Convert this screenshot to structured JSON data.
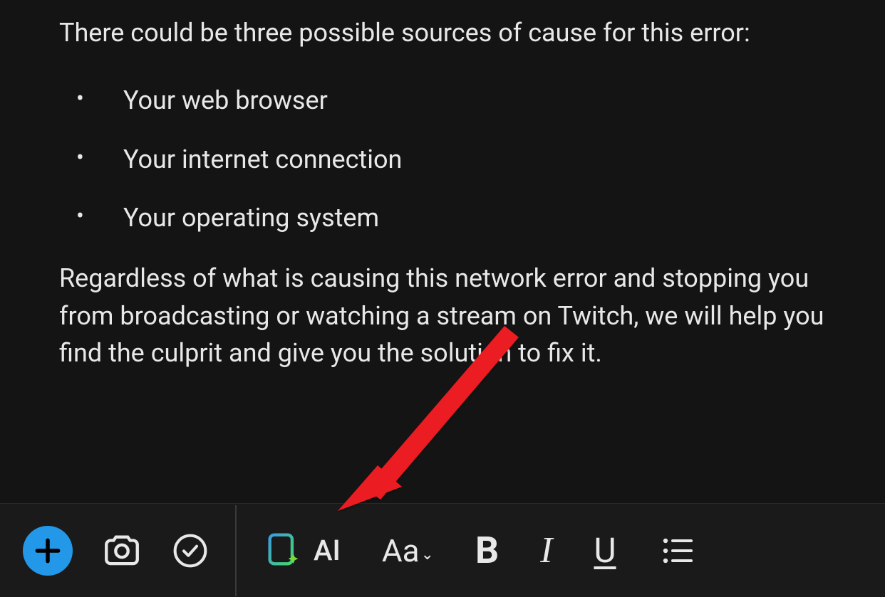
{
  "content": {
    "intro": "There could be three possible sources of cause for this error:",
    "bullets": [
      "Your web browser",
      "Your internet connection",
      "Your operating system"
    ],
    "outro": "Regardless of what is causing this network error and stopping you from broadcasting or watching a stream on Twitch, we will help you find the culprit and give you the solution to fix it."
  },
  "annotation": {
    "arrow_color": "#eb1c24"
  },
  "toolbar": {
    "ai_label": "AI",
    "format_label": "Aa",
    "bold_label": "B",
    "italic_label": "I",
    "underline_label": "U"
  }
}
